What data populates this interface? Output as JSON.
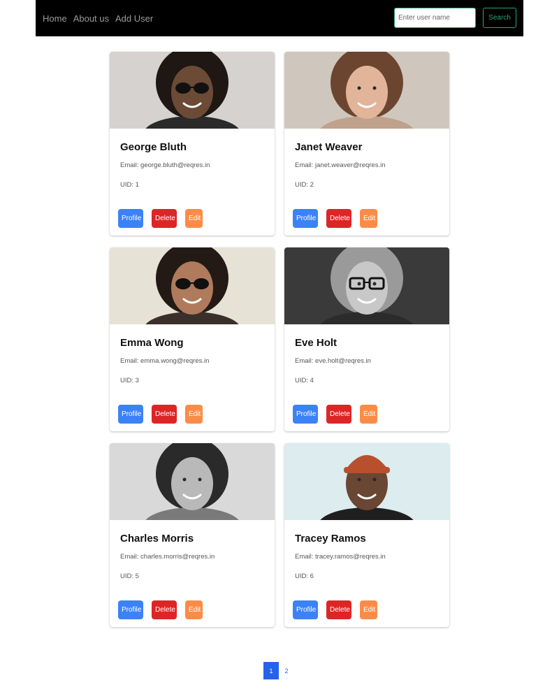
{
  "nav": {
    "links": [
      "Home",
      "About us",
      "Add User"
    ],
    "search_placeholder": "Enter user name",
    "search_label": "Search"
  },
  "users": [
    {
      "name": "George Bluth",
      "email": "Email: george.bluth@reqres.in",
      "uid": "UID: 1",
      "photo": {
        "bg": "#d6d2cf",
        "skin": "#6b4a36",
        "hair": "#1e1714",
        "shirt": "#2a2a2a",
        "sunglasses": true,
        "hat": false,
        "grayscale": false
      }
    },
    {
      "name": "Janet Weaver",
      "email": "Email: janet.weaver@reqres.in",
      "uid": "UID: 2",
      "photo": {
        "bg": "#cfc7bd",
        "skin": "#e2b49a",
        "hair": "#6b4530",
        "shirt": "#bfa28c",
        "sunglasses": false,
        "hat": false,
        "grayscale": false
      }
    },
    {
      "name": "Emma Wong",
      "email": "Email: emma.wong@reqres.in",
      "uid": "UID: 3",
      "photo": {
        "bg": "#e7e2d6",
        "skin": "#b07b5c",
        "hair": "#241a15",
        "shirt": "#3a2f2a",
        "sunglasses": true,
        "hat": false,
        "grayscale": false
      }
    },
    {
      "name": "Eve Holt",
      "email": "Email: eve.holt@reqres.in",
      "uid": "UID: 4",
      "photo": {
        "bg": "#3a3a3a",
        "skin": "#c8c8c8",
        "hair": "#9a9a9a",
        "shirt": "#2b2b2b",
        "sunglasses": false,
        "glasses": true,
        "hat": false,
        "grayscale": true
      }
    },
    {
      "name": "Charles Morris",
      "email": "Email: charles.morris@reqres.in",
      "uid": "UID: 5",
      "photo": {
        "bg": "#d9d9dc",
        "skin": "#b9b9b9",
        "hair": "#2a2a2a",
        "shirt": "#7a7a7a",
        "sunglasses": false,
        "hat": false,
        "grayscale": true
      }
    },
    {
      "name": "Tracey Ramos",
      "email": "Email: tracey.ramos@reqres.in",
      "uid": "UID: 6",
      "photo": {
        "bg": "#dcecef",
        "skin": "#6a4634",
        "hair": "#1b1b1b",
        "shirt": "#1f1f1f",
        "sunglasses": false,
        "hat": true,
        "hat_color": "#b8502d",
        "grayscale": false
      }
    }
  ],
  "buttons": {
    "profile": "Profile",
    "delete": "Delete",
    "edit": "Edit"
  },
  "pagination": {
    "pages": [
      "1",
      "2"
    ],
    "active": "1"
  }
}
